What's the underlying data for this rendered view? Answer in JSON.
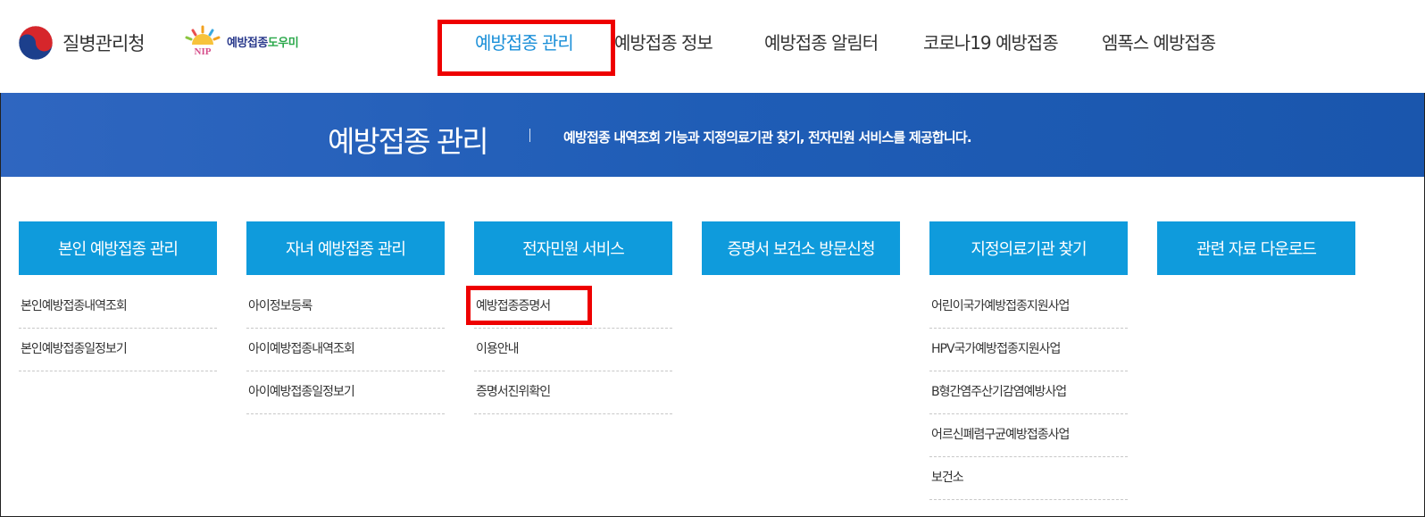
{
  "header": {
    "kdca_logo_text": "질병관리청",
    "nip_logo_text_main": "예방접종",
    "nip_logo_text_accent": "도우미",
    "nip_logo_badge": "NIP",
    "nav": [
      {
        "label": "예방접종 관리",
        "active": true
      },
      {
        "label": "예방접종 정보",
        "active": false
      },
      {
        "label": "예방접종 알림터",
        "active": false
      },
      {
        "label": "코로나19 예방접종",
        "active": false
      },
      {
        "label": "엠폭스 예방접종",
        "active": false
      }
    ]
  },
  "banner": {
    "title": "예방접종 관리",
    "description": "예방접종 내역조회 기능과 지정의료기관 찾기, 전자민원 서비스를 제공합니다."
  },
  "menu": [
    {
      "title": "본인 예방접종 관리",
      "links": [
        "본인예방접종내역조회",
        "본인예방접종일정보기"
      ]
    },
    {
      "title": "자녀 예방접종 관리",
      "links": [
        "아이정보등록",
        "아이예방접종내역조회",
        "아이예방접종일정보기"
      ]
    },
    {
      "title": "전자민원 서비스",
      "links": [
        "예방접종증명서",
        "이용안내",
        "증명서진위확인"
      ]
    },
    {
      "title": "증명서 보건소 방문신청",
      "links": []
    },
    {
      "title": "지정의료기관 찾기",
      "links": [
        "어린이국가예방접종지원사업",
        "HPV국가예방접종지원사업",
        "B형간염주산기감염예방사업",
        "어르신폐렴구균예방접종사업",
        "보건소"
      ]
    },
    {
      "title": "관련 자료 다운로드",
      "links": []
    }
  ],
  "colors": {
    "accent": "#1a8fd8",
    "menu_header": "#0f9bdc",
    "banner": "#2060b8",
    "highlight": "#ee0000"
  }
}
